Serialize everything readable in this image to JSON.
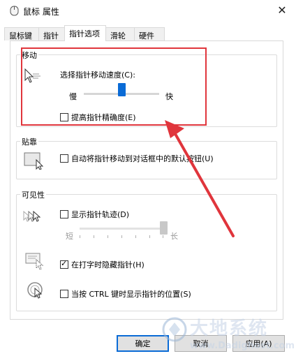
{
  "window": {
    "title": "鼠标 属性"
  },
  "tabs": [
    {
      "label": "鼠标键"
    },
    {
      "label": "指针"
    },
    {
      "label": "指针选项"
    },
    {
      "label": "滑轮"
    },
    {
      "label": "硬件"
    }
  ],
  "motion": {
    "label": "移动",
    "speed_label": "选择指针移动速度(C):",
    "slow_label": "慢",
    "fast_label": "快",
    "speed_level": 0.5,
    "precision_label": "提高指针精确度(E)",
    "precision_checked": false
  },
  "snap": {
    "label": "贴靠",
    "checkbox_label": "自动将指针移动到对话框中的默认按钮(U)",
    "checked": false
  },
  "visibility": {
    "label": "可见性",
    "trails_label": "显示指针轨迹(D)",
    "trails_checked": false,
    "short_label": "短",
    "long_label": "长",
    "trail_level": 1.0,
    "hide_label": "在打字时隐藏指针(H)",
    "hide_checked": true,
    "ctrl_label": "当按 CTRL 键时显示指针的位置(S)",
    "ctrl_checked": false
  },
  "buttons": {
    "ok": "确定",
    "cancel": "取消",
    "apply": "应用(A)"
  },
  "watermark": {
    "text": "大地系统",
    "subtext": "www.Dadighost.com"
  },
  "colors": {
    "accent": "#0a6bd6",
    "annotation": "#e0353c"
  }
}
